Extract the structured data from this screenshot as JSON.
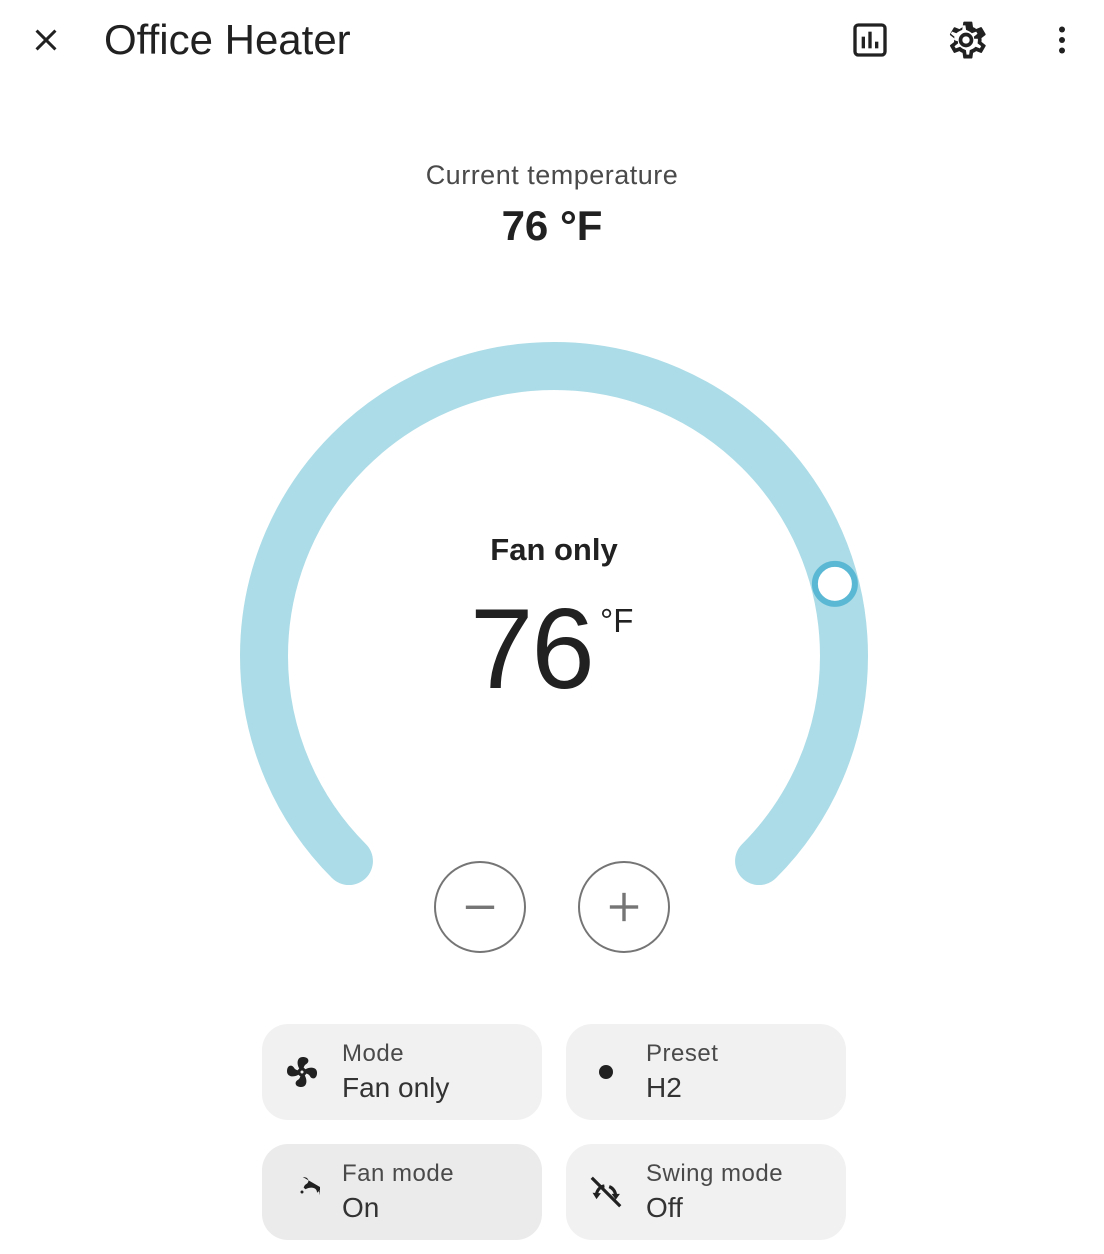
{
  "header": {
    "title": "Office Heater",
    "close_icon": "close-icon",
    "history_icon": "chart-box-icon",
    "settings_icon": "gear-icon",
    "menu_icon": "dots-vertical-icon"
  },
  "current": {
    "label": "Current temperature",
    "value": "76 °F"
  },
  "thermostat": {
    "mode_label": "Fan only",
    "target_value": "76",
    "unit": "°F",
    "arc_color": "#acdce7",
    "knob_color": "#5bb8d4",
    "knob_position_fraction": 0.78,
    "decrease_label": "−",
    "increase_label": "+"
  },
  "tiles": [
    {
      "label": "Mode",
      "value": "Fan only",
      "icon": "fan-icon"
    },
    {
      "label": "Preset",
      "value": "H2",
      "icon": "dot-icon"
    },
    {
      "label": "Fan mode",
      "value": "On",
      "icon": "fan-icon"
    },
    {
      "label": "Swing mode",
      "value": "Off",
      "icon": "swing-off-icon"
    }
  ]
}
